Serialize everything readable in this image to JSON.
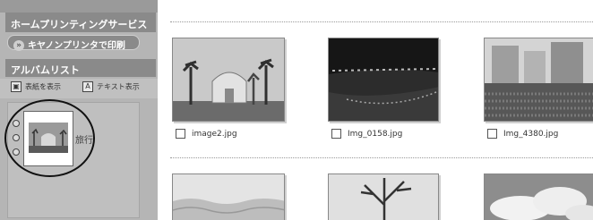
{
  "sidebar": {
    "service_title": "ホームプリンティングサービス",
    "print_button": "キヤノンプリンタで印刷",
    "album_title": "アルバムリスト",
    "view_buttons": [
      "表紙を表示",
      "テキスト表示"
    ],
    "album_name": "旅行"
  },
  "photos": [
    {
      "filename": "image2.jpg"
    },
    {
      "filename": "Img_0158.jpg"
    },
    {
      "filename": "Img_4380.jpg"
    }
  ],
  "colors": {
    "sidebar_bg": "#b5b5b5",
    "header_bg": "#8a8a8a"
  }
}
